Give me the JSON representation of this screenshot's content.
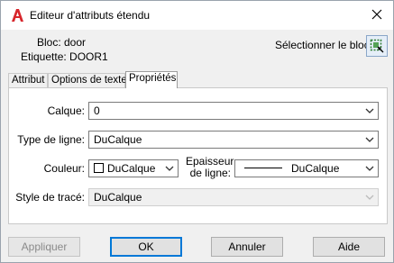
{
  "window": {
    "title": "Editeur d'attributs étendu"
  },
  "info": {
    "block_label": "Bloc: door",
    "tag_label": "Etiquette: DOOR1",
    "select_block_label": "Sélectionner le bloc"
  },
  "tabs": [
    {
      "label": "Attribut"
    },
    {
      "label": "Options de texte"
    },
    {
      "label": "Propriétés"
    }
  ],
  "properties": {
    "layer_label": "Calque:",
    "layer_value": "0",
    "linetype_label": "Type de ligne:",
    "linetype_value": "DuCalque",
    "color_label": "Couleur:",
    "color_value": "DuCalque",
    "lineweight_label_1": "Epaisseur",
    "lineweight_label_2": "de ligne:",
    "lineweight_value": "DuCalque",
    "plotstyle_label": "Style de tracé:",
    "plotstyle_value": "DuCalque"
  },
  "buttons": {
    "apply": "Appliquer",
    "ok": "OK",
    "cancel": "Annuler",
    "help": "Aide"
  },
  "colors": {
    "accent": "#0078d7",
    "app_icon_red": "#d7262c"
  }
}
